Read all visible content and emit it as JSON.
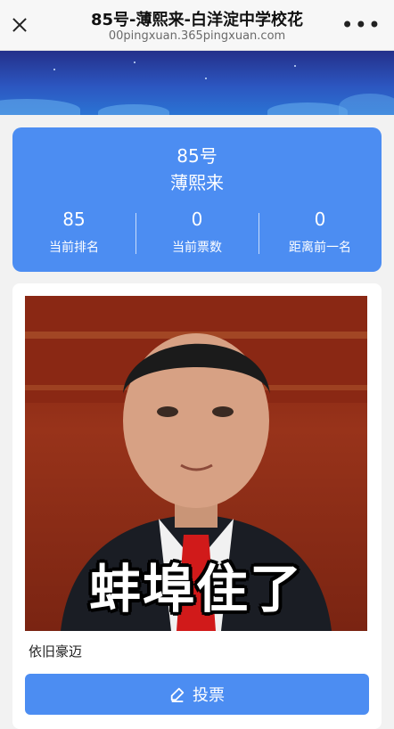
{
  "topbar": {
    "title": "85号-薄熙来-白洋淀中学校花",
    "url": "00pingxuan.365pingxuan.com",
    "close_icon": "close-icon",
    "more_icon": "more-icon"
  },
  "stats": {
    "number_title": "85号",
    "name_title": "薄熙来",
    "items": [
      {
        "value": "85",
        "label": "当前排名"
      },
      {
        "value": "0",
        "label": "当前票数"
      },
      {
        "value": "0",
        "label": "距离前一名"
      }
    ]
  },
  "card": {
    "caption": "蚌埠住了",
    "description": "依旧豪迈",
    "vote_label": "投票",
    "vote_icon": "edit-icon"
  },
  "colors": {
    "accent": "#4c8df2",
    "banner": "#2c56c0"
  }
}
